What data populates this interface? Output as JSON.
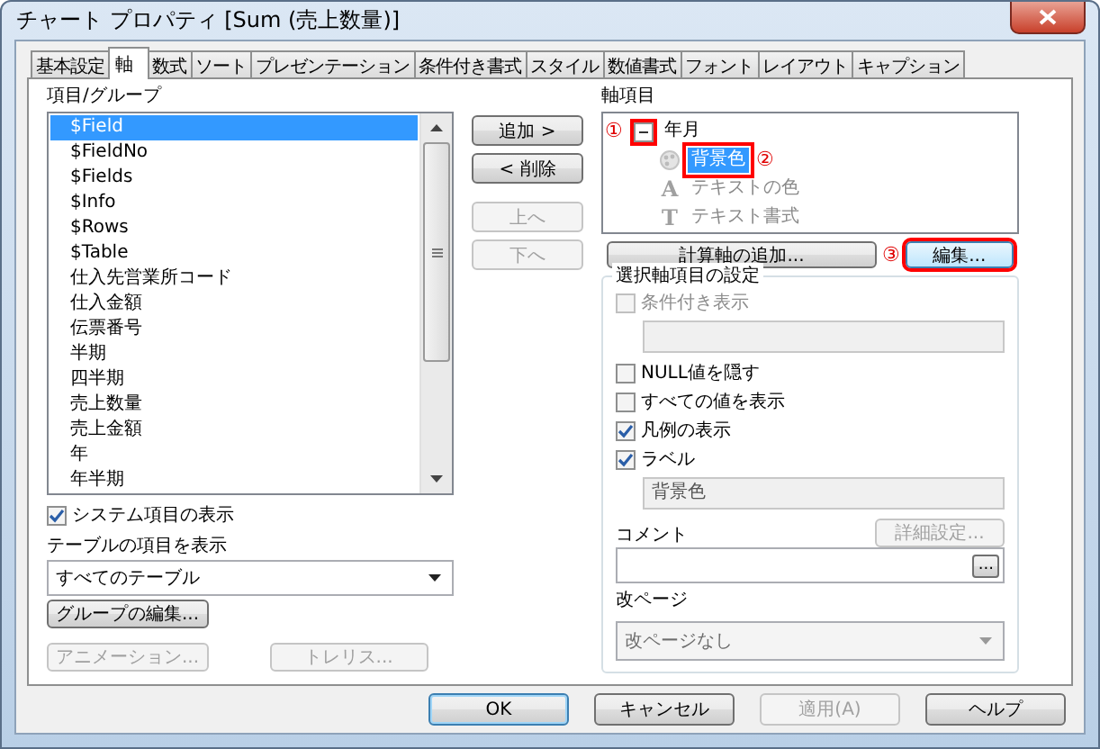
{
  "window": {
    "title": "チャート プロパティ [Sum (売上数量)]"
  },
  "tabs": [
    {
      "label": "基本設定",
      "selected": false
    },
    {
      "label": "軸",
      "selected": true
    },
    {
      "label": "数式",
      "selected": false
    },
    {
      "label": "ソート",
      "selected": false
    },
    {
      "label": "プレゼンテーション",
      "selected": false
    },
    {
      "label": "条件付き書式",
      "selected": false
    },
    {
      "label": "スタイル",
      "selected": false
    },
    {
      "label": "数値書式",
      "selected": false
    },
    {
      "label": "フォント",
      "selected": false
    },
    {
      "label": "レイアウト",
      "selected": false
    },
    {
      "label": "キャプション",
      "selected": false
    }
  ],
  "fields": {
    "label": "項目/グループ",
    "items": [
      {
        "label": "$Field",
        "selected": true
      },
      {
        "label": "$FieldNo",
        "selected": false
      },
      {
        "label": "$Fields",
        "selected": false
      },
      {
        "label": "$Info",
        "selected": false
      },
      {
        "label": "$Rows",
        "selected": false
      },
      {
        "label": "$Table",
        "selected": false
      },
      {
        "label": "仕入先営業所コード",
        "selected": false
      },
      {
        "label": "仕入金額",
        "selected": false
      },
      {
        "label": "伝票番号",
        "selected": false
      },
      {
        "label": "半期",
        "selected": false
      },
      {
        "label": "四半期",
        "selected": false
      },
      {
        "label": "売上数量",
        "selected": false
      },
      {
        "label": "売上金額",
        "selected": false
      },
      {
        "label": "年",
        "selected": false
      },
      {
        "label": "年半期",
        "selected": false
      }
    ]
  },
  "show_system_fields": {
    "label": "システム項目の表示",
    "checked": true
  },
  "table_filter": {
    "label": "テーブルの項目を表示",
    "value": "すべてのテーブル"
  },
  "group_edit_button": {
    "label": "グループの編集..."
  },
  "extra_buttons": [
    {
      "label": "アニメーション...",
      "disabled": true
    },
    {
      "label": "トレリス...",
      "disabled": true
    }
  ],
  "move_buttons": [
    {
      "label": "追加 >",
      "disabled": false
    },
    {
      "label": "< 削除",
      "disabled": false
    },
    {
      "label": "上へ",
      "disabled": true
    },
    {
      "label": "下へ",
      "disabled": true
    }
  ],
  "dimensions": {
    "label": "軸項目",
    "tree": [
      {
        "label": "年月",
        "expanded": true,
        "callout": "①",
        "children": [
          {
            "label": "背景色",
            "kind": "background",
            "selected": true,
            "callout": "②"
          },
          {
            "label": "テキストの色",
            "kind": "text-color",
            "icon_glyph": "A",
            "selected": false
          },
          {
            "label": "テキスト書式",
            "kind": "text-format",
            "icon_glyph": "T",
            "selected": false
          }
        ]
      }
    ]
  },
  "dimension_buttons": [
    {
      "label": "計算軸の追加..."
    },
    {
      "label": "編集...",
      "callout": "③"
    }
  ],
  "settings": {
    "title": "選択軸項目の設定",
    "rows": [
      {
        "kind": "checkbox",
        "label": "条件付き表示",
        "checked": false,
        "disabled": true
      },
      {
        "kind": "field",
        "disabled": true
      },
      {
        "kind": "checkbox",
        "label": "NULL値を隠す",
        "checked": false,
        "disabled": false
      },
      {
        "kind": "checkbox",
        "label": "すべての値を表示",
        "checked": false,
        "disabled": false
      },
      {
        "kind": "checkbox",
        "label": "凡例の表示",
        "checked": true,
        "disabled": false
      },
      {
        "kind": "checkbox",
        "label": "ラベル",
        "checked": true,
        "disabled": false
      },
      {
        "kind": "field",
        "value": "背景色",
        "disabled": true
      },
      {
        "kind": "label-button",
        "label": "コメント",
        "button": "詳細設定...",
        "disabled": true
      },
      {
        "kind": "browse-field",
        "button": "..."
      },
      {
        "kind": "label",
        "label": "改ページ"
      },
      {
        "kind": "select",
        "value": "改ページなし",
        "disabled": true
      }
    ]
  },
  "footer_buttons": [
    {
      "label": "OK",
      "kind": "default",
      "disabled": false
    },
    {
      "label": "キャンセル",
      "kind": "normal",
      "disabled": false
    },
    {
      "label": "適用(A)",
      "kind": "normal",
      "disabled": true
    },
    {
      "label": "ヘルプ",
      "kind": "normal",
      "disabled": false
    }
  ]
}
